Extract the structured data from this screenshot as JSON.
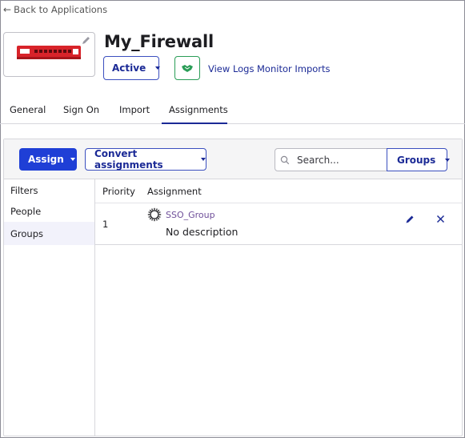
{
  "header": {
    "back_label": "Back to Applications",
    "app_title": "My_Firewall",
    "status_label": "Active",
    "links": {
      "view_logs": "View Logs",
      "monitor_imports": "Monitor Imports"
    }
  },
  "tabs": [
    {
      "label": "General"
    },
    {
      "label": "Sign On"
    },
    {
      "label": "Import"
    },
    {
      "label": "Assignments",
      "active": true
    }
  ],
  "toolbar": {
    "assign_label": "Assign",
    "convert_label": "Convert assignments",
    "search_placeholder": "Search...",
    "search_value": "",
    "groups_label": "Groups"
  },
  "filters": {
    "title": "Filters",
    "items": [
      {
        "label": "People",
        "selected": false
      },
      {
        "label": "Groups",
        "selected": true
      }
    ]
  },
  "table": {
    "columns": [
      "Priority",
      "Assignment"
    ],
    "rows": [
      {
        "priority": "1",
        "name": "SSO_Group",
        "description": "No description"
      }
    ]
  },
  "icons": {
    "back": "left-arrow-icon",
    "logo_edit": "pencil-icon",
    "push": "handshake-icon",
    "search": "search-icon",
    "group": "group-icon",
    "row_edit": "pencil-icon",
    "row_remove": "close-icon"
  },
  "colors": {
    "primary": "#1f3fd6",
    "link": "#1b2a96",
    "push_green": "#2a9d57",
    "group_name": "#6e4e99",
    "device_red": "#d8232a"
  }
}
